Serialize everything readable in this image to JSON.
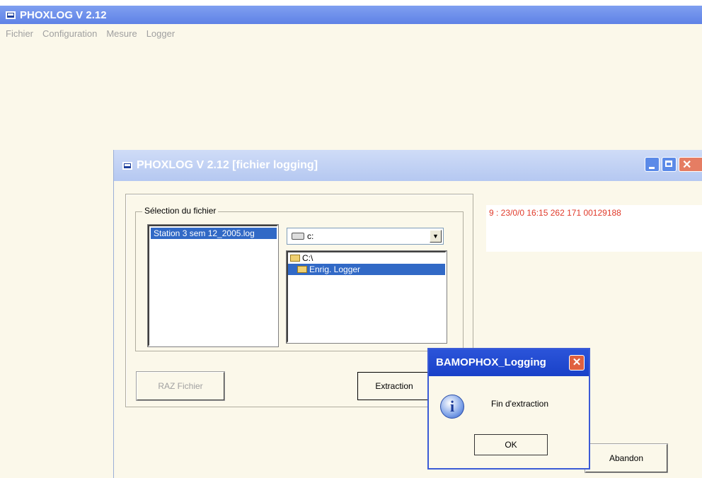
{
  "app": {
    "title": "PHOXLOG   V 2.12"
  },
  "menu": [
    "Fichier",
    "Configuration",
    "Mesure",
    "Logger"
  ],
  "child_window": {
    "title": "PHOXLOG   V 2.12 [fichier logging]",
    "groupbox_label": "Sélection du fichier",
    "file_list": [
      "Station 3 sem 12_2005.log"
    ],
    "drive": "c:",
    "directories": [
      {
        "name": "C:\\",
        "selected": false
      },
      {
        "name": "Enrig. Logger",
        "selected": true
      }
    ],
    "status_text": "9 : 23/0/0 16:15  262 171 00129188",
    "buttons": {
      "raz": "RAZ Fichier",
      "extraction": "Extraction",
      "abandon": "Abandon"
    }
  },
  "dialog": {
    "title": "BAMOPHOX_Logging",
    "icon": "info-icon",
    "message": "Fin d'extraction",
    "ok_label": "OK"
  },
  "colors": {
    "titlebar_active": "#5f82e6",
    "titlebar_inactive": "#b5c8f1",
    "selection": "#3169c6",
    "status_text": "#e03a2a",
    "window_bg": "#fbf8ea"
  }
}
